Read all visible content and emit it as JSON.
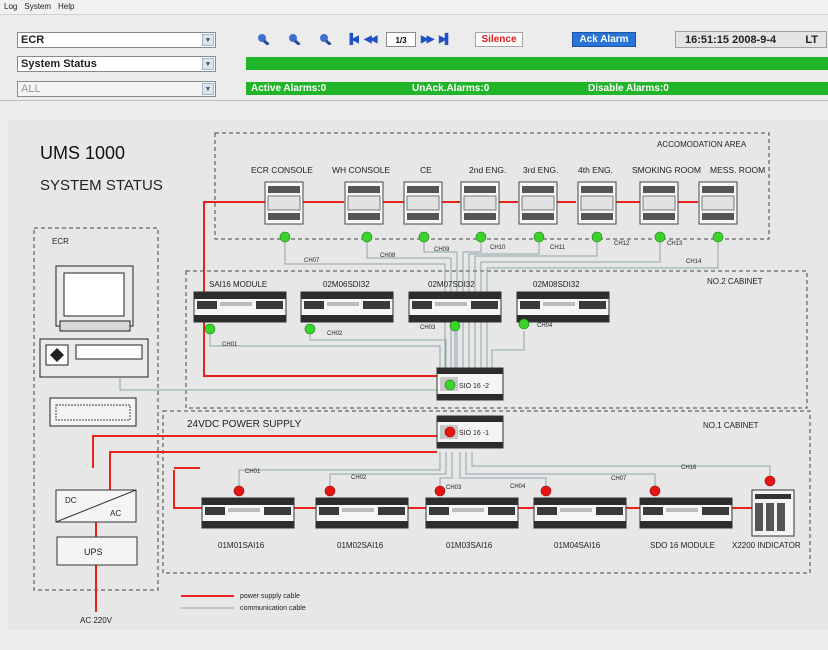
{
  "menu": {
    "items": [
      "Log",
      "System",
      "Help"
    ]
  },
  "toolbar": {
    "location_value": "ECR",
    "view_value": "System Status",
    "filter_value": "ALL",
    "page_indicator": "1/3",
    "silence_label": "Silence",
    "ack_alarm_label": "Ack Alarm",
    "time": "16:51:15 2008-9-4",
    "time_zone": "LT"
  },
  "alarm_bar": {
    "active": "Active Alarms:0",
    "unack": "UnAck.Alarms:0",
    "disabled": "Disable Alarms:0",
    "color": "#21b52a"
  },
  "diagram": {
    "title": "UMS 1000",
    "subtitle": "SYSTEM STATUS",
    "areas": {
      "accommodation": "ACCOMODATION AREA",
      "no2_cabinet": "NO.2 CABINET",
      "no1_cabinet": "NO.1 CABINET",
      "ecr": "ECR",
      "power_supply": "24VDC POWER SUPPLY"
    },
    "consoles": [
      "ECR CONSOLE",
      "WH CONSOLE",
      "CE",
      "2nd ENG.",
      "3rd ENG.",
      "4th ENG.",
      "SMOKING ROOM",
      "MESS. ROOM"
    ],
    "accommodation_channels": [
      "CH07",
      "CH08",
      "CH09",
      "CH10",
      "CH11",
      "CH12",
      "CH13",
      "CH14"
    ],
    "no2_modules": [
      "SAI16 MODULE",
      "02M06SDI32",
      "02M07SDI32",
      "02M08SDI32"
    ],
    "no2_channels": [
      "CH01",
      "CH02",
      "CH03",
      "CH04"
    ],
    "sio2": "SIO 16 -2",
    "sio1": "SIO 16 -1",
    "no1_modules": [
      "01M01SAI16",
      "01M02SAI16",
      "01M03SAI16",
      "01M04SAI16",
      "SDO 16 MODULE",
      "X2200 INDICATOR"
    ],
    "no1_channels": [
      "CH01",
      "CH02",
      "CH03",
      "CH04",
      "CH07",
      "CH16"
    ],
    "dc": "DC",
    "ac": "AC",
    "ups": "UPS",
    "ac_supply": "AC 220V",
    "legend": {
      "power": "power supply cable",
      "comm": "communication cable"
    },
    "colors": {
      "power_cable": "#e8231c",
      "comm_cable": "#8fa4a8",
      "ok_led": "#3bd42a",
      "alarm_led": "#e81414"
    }
  }
}
